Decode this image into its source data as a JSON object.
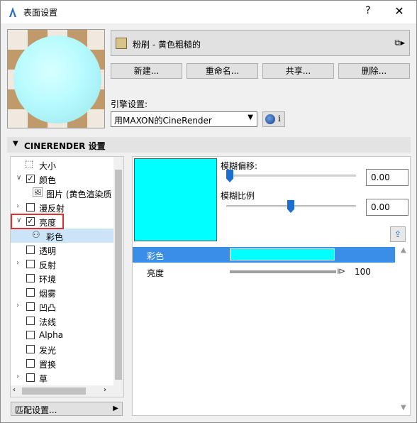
{
  "window": {
    "title": "表面设置",
    "help_label": "?",
    "close_label": "✕"
  },
  "material": {
    "name": "粉刷 - 黄色粗糙的",
    "swatch_color": "#d8c48a",
    "buttons": {
      "new": "新建...",
      "rename": "重命名...",
      "share": "共享...",
      "delete": "删除..."
    }
  },
  "engine": {
    "label": "引擎设置:",
    "selected": "用MAXON的CineRender",
    "info": "i"
  },
  "section": {
    "title": "CINERENDER 设置"
  },
  "tree": {
    "items": [
      {
        "label": "大小",
        "expand": "",
        "check": "none",
        "icon": "size-icon"
      },
      {
        "label": "颜色",
        "expand": "expanded",
        "check": "checked"
      },
      {
        "label": "图片 (黄色渲染质",
        "expand": "",
        "check": "none",
        "icon": "image-icon",
        "child": true
      },
      {
        "label": "漫反射",
        "expand": "collapsed",
        "check": "unchecked"
      },
      {
        "label": "亮度",
        "expand": "expanded",
        "check": "checked"
      },
      {
        "label": "彩色",
        "expand": "",
        "check": "none",
        "icon": "color-node-icon",
        "child": true,
        "selected": true
      },
      {
        "label": "透明",
        "expand": "",
        "check": "unchecked"
      },
      {
        "label": "反射",
        "expand": "collapsed",
        "check": "unchecked"
      },
      {
        "label": "环境",
        "expand": "",
        "check": "unchecked"
      },
      {
        "label": "烟雾",
        "expand": "",
        "check": "unchecked"
      },
      {
        "label": "凹凸",
        "expand": "collapsed",
        "check": "unchecked"
      },
      {
        "label": "法线",
        "expand": "",
        "check": "unchecked"
      },
      {
        "label": "Alpha",
        "expand": "",
        "check": "unchecked"
      },
      {
        "label": "发光",
        "expand": "",
        "check": "unchecked"
      },
      {
        "label": "置换",
        "expand": "",
        "check": "unchecked"
      },
      {
        "label": "草",
        "expand": "collapsed",
        "check": "unchecked"
      }
    ],
    "match_button": "匹配设置..."
  },
  "detail": {
    "swatch_color": "#00ffff",
    "blur_offset_label": "模糊偏移:",
    "blur_offset_value": "0.00",
    "blur_scale_label": "模糊比例",
    "blur_scale_value": "0.00",
    "properties": [
      {
        "label": "彩色",
        "kind": "color",
        "color": "#00ffff"
      },
      {
        "label": "亮度",
        "kind": "slider",
        "value": "100"
      }
    ]
  }
}
